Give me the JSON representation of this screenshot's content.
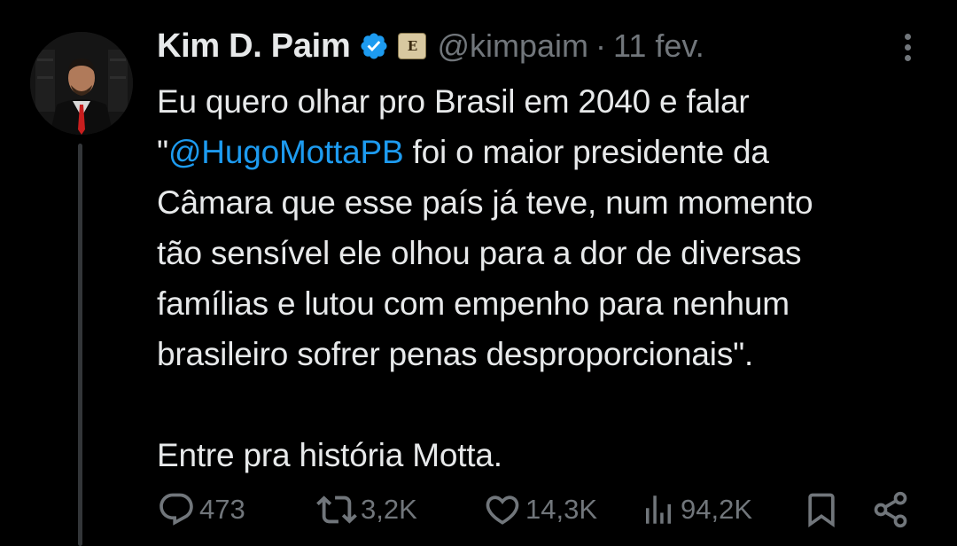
{
  "author": {
    "name": "Kim D. Paim",
    "handle": "@kimpaim",
    "separator": "·",
    "date": "11 fev.",
    "affiliation_badge": "E"
  },
  "tweet": {
    "lines": [
      "Eu quero olhar pro Brasil em 2040 e falar",
      "foi o maior presidente da",
      "Câmara que esse país já teve, num momento",
      "tão sensível ele olhou para a dor de diversas",
      "famílias e lutou com empenho para nenhum",
      "brasileiro sofrer penas desproporcionais\".",
      "Entre pra história Motta."
    ],
    "quote_open": "\"",
    "mention": "@HugoMottaPB"
  },
  "actions": {
    "replies": "473",
    "reposts": "3,2K",
    "likes": "14,3K",
    "views": "94,2K"
  },
  "colors": {
    "background": "#000000",
    "text": "#e7e9ea",
    "muted": "#71767b",
    "accent": "#1d9bf0"
  },
  "icons": {
    "verified": "verified-badge-icon",
    "more": "more-dots-icon",
    "reply": "reply-icon",
    "repost": "repost-icon",
    "like": "heart-icon",
    "views": "views-chart-icon",
    "bookmark": "bookmark-icon",
    "share": "share-icon"
  }
}
